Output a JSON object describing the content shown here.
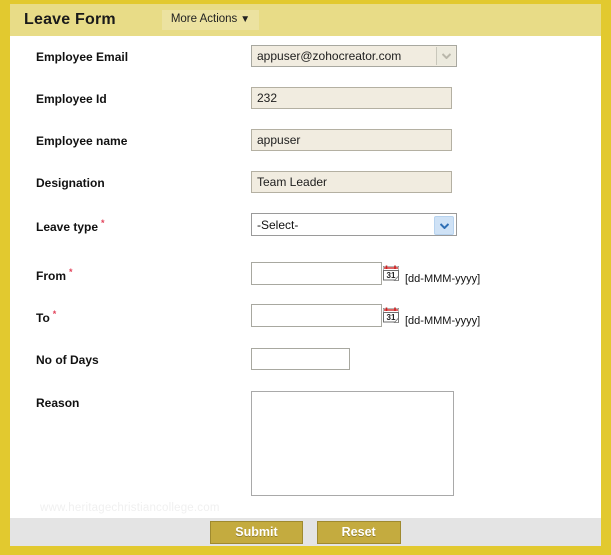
{
  "header": {
    "title": "Leave Form",
    "more_actions_label": "More Actions",
    "more_actions_caret": "▼"
  },
  "colors": {
    "frame_gold": "#e2c92f",
    "header_band": "#e8dc87",
    "footer_grey": "#e4e4e4",
    "button_gold": "#c4ab3f",
    "required_red": "#e2445c",
    "readonly_beige": "#f1ece0",
    "active_arrow_blue": "#2f6fb5"
  },
  "fields": [
    {
      "label": "Employee Email",
      "required": false,
      "type": "select-readonly",
      "value": "appuser@zohocreator.com",
      "icon": "chevron-down-icon"
    },
    {
      "label": "Employee Id",
      "required": false,
      "type": "text-readonly",
      "value": "232"
    },
    {
      "label": "Employee name",
      "required": false,
      "type": "text-readonly",
      "value": "appuser"
    },
    {
      "label": "Designation",
      "required": false,
      "type": "text-readonly",
      "value": "Team Leader"
    },
    {
      "label": "Leave type",
      "required": true,
      "type": "select",
      "value": "-Select-",
      "icon": "chevron-down-icon"
    },
    {
      "label": "From",
      "required": true,
      "type": "date",
      "value": "",
      "hint": "[dd-MMM-yyyy]",
      "icon": "calendar-icon",
      "icon_day": "31"
    },
    {
      "label": "To",
      "required": true,
      "type": "date",
      "value": "",
      "hint": "[dd-MMM-yyyy]",
      "icon": "calendar-icon",
      "icon_day": "31"
    },
    {
      "label": "No of Days",
      "required": false,
      "type": "text",
      "value": ""
    },
    {
      "label": "Reason",
      "required": false,
      "type": "textarea",
      "value": ""
    }
  ],
  "required_marker": "*",
  "watermark": "www.heritagechristiancollege.com",
  "footer": {
    "submit_label": "Submit",
    "reset_label": "Reset"
  }
}
